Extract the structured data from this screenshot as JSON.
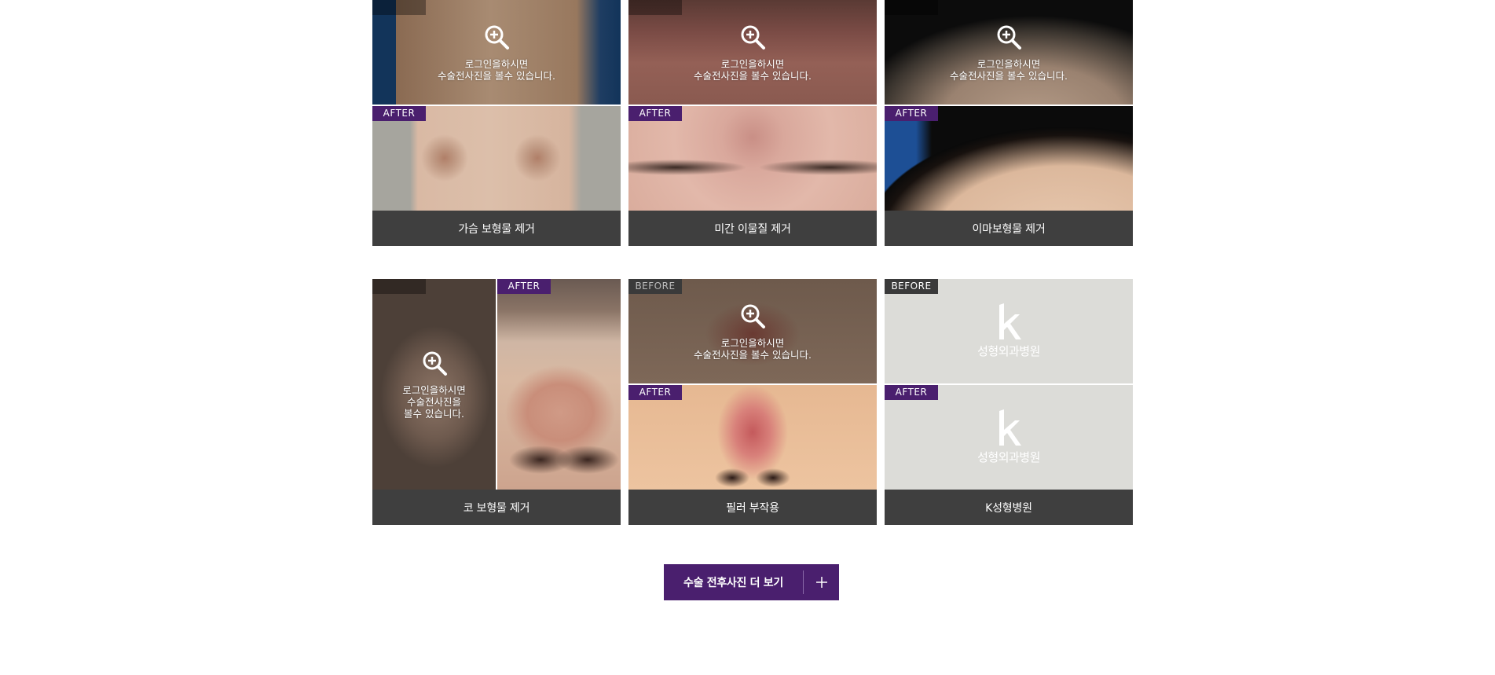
{
  "cards": [
    {
      "caption": "가슴 보형물 제거",
      "after_tag": "AFTER",
      "login_line1": "로그인을하시면",
      "login_line2": "수술전사진을 볼수 있습니다."
    },
    {
      "caption": "미간 이물질 제거",
      "after_tag": "AFTER",
      "login_line1": "로그인을하시면",
      "login_line2": "수술전사진을 볼수 있습니다."
    },
    {
      "caption": "이마보형물 제거",
      "after_tag": "AFTER",
      "login_line1": "로그인을하시면",
      "login_line2": "수술전사진을 볼수 있습니다."
    },
    {
      "caption": "코 보형물 제거",
      "after_tag": "AFTER",
      "login_line1": "로그인을하시면",
      "login_line2": "수술전사진을",
      "login_line3": "볼수 있습니다."
    },
    {
      "caption": "필러 부작용",
      "before_tag": "BEFORE",
      "after_tag": "AFTER",
      "login_line1": "로그인을하시면",
      "login_line2": "수술전사진을 볼수 있습니다."
    },
    {
      "caption": "K성형병원",
      "before_tag": "BEFORE",
      "after_tag": "AFTER",
      "logo_text": "성형외과병원"
    }
  ],
  "more_button": {
    "label": "수술 전후사진 더 보기",
    "icon": "plus-icon"
  },
  "colors": {
    "accent": "#4a1f6e",
    "caption_bg": "#3f3f3f",
    "placeholder_bg": "#dcdcd8"
  }
}
